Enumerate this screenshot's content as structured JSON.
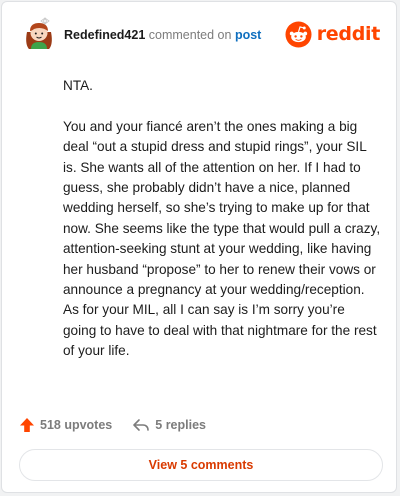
{
  "header": {
    "username": "Redefined421",
    "action_text": "commented on",
    "post_link": "post",
    "brand_name": "reddit",
    "avatar_icon": "cartoon-avatar-icon",
    "brand_icon": "reddit-snoo-icon"
  },
  "comment": {
    "paragraphs": [
      "NTA.",
      "You and your fiancé aren’t the ones making a big deal “out a stupid dress and stupid rings”, your SIL is. She wants all of the attention on her. If I had to guess, she probably didn’t have a nice, planned wedding herself, so she’s trying to make up for that now. She seems like the type that would pull a crazy, attention-seeking stunt at your wedding, like having her husband “propose” to her to renew their vows or announce a pregnancy at your wedding/reception. As for your MIL, all I can say is I’m sorry you’re going to have to deal with that nightmare for the rest of your life."
    ]
  },
  "actions": {
    "upvotes_label": "518 upvotes",
    "replies_label": "5 replies",
    "upvote_icon": "upvote-arrow-icon",
    "reply_icon": "reply-arrow-icon"
  },
  "footer": {
    "view_comments_label": "View 5 comments"
  },
  "colors": {
    "brand": "#ff4500",
    "link": "#0f6fbf",
    "button_text": "#d93a00",
    "muted": "#7c7c7c",
    "text": "#1c1c1c"
  }
}
